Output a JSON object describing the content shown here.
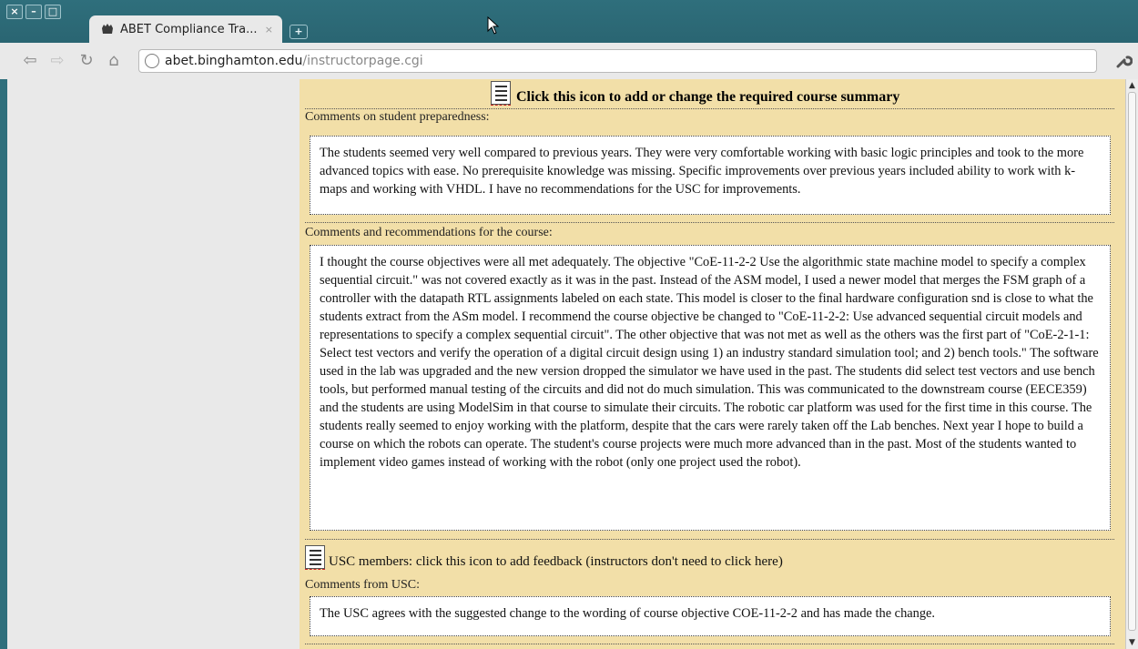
{
  "window": {
    "controls": [
      "×",
      "–",
      "□"
    ]
  },
  "tab": {
    "title": "ABET Compliance Tra...",
    "close": "×",
    "new_tab": "+"
  },
  "address": {
    "host": "abet.binghamton.edu",
    "path": "/instructorpage.cgi"
  },
  "page": {
    "heading": "Click this icon to add or change the required course summary",
    "preparedness": {
      "label": "Comments on student preparedness:",
      "text": "The students seemed very well compared to previous years. They were very comfortable working with basic logic principles and took to the more advanced topics with ease. No prerequisite knowledge was missing. Specific improvements over previous years included ability to work with k-maps and working with VHDL. I have no recommendations for the USC for improvements."
    },
    "recommendations": {
      "label": "Comments and recommendations for the course:",
      "text": "I thought the course objectives were all met adequately. The objective \"CoE-11-2-2 Use the algorithmic state machine model to specify a complex sequential circuit.\" was not covered exactly as it was in the past. Instead of the ASM model, I used a newer model that merges the FSM graph of a controller with the datapath RTL assignments labeled on each state. This model is closer to the final hardware configuration snd is close to what the students extract from the ASm model. I recommend the course objective be changed to \"CoE-11-2-2: Use advanced sequential circuit models and representations to specify a complex sequential circuit\". The other objective that was not met as well as the others was the first part of \"CoE-2-1-1: Select test vectors and verify the operation of a digital circuit design using 1) an industry standard simulation tool; and 2) bench tools.\" The software used in the lab was upgraded and the new version dropped the simulator we have used in the past. The students did select test vectors and use bench tools, but performed manual testing of the circuits and did not do much simulation. This was communicated to the downstream course (EECE359) and the students are using ModelSim in that course to simulate their circuits. The robotic car platform was used for the first time in this course. The students really seemed to enjoy working with the platform, despite that the cars were rarely taken off the Lab benches. Next year I hope to build a course on which the robots can operate. The student's course projects were much more advanced than in the past. Most of the students wanted to implement video games instead of working with the robot (only one project used the robot)."
    },
    "usc_feedback_link": "USC members: click this icon to add feedback (instructors don't need to click here)",
    "usc_comments": {
      "label": "Comments from USC:",
      "text": "The USC agrees with the suggested change to the wording of course objective COE-11-2-2 and has made the change."
    }
  },
  "colors": {
    "titlebar": "#2f6f7c",
    "page_background": "#f2dfa8"
  },
  "icons": [
    "favicon-icon",
    "back-icon",
    "forward-icon",
    "reload-icon",
    "home-icon",
    "globe-icon",
    "wrench-icon",
    "document-icon"
  ]
}
